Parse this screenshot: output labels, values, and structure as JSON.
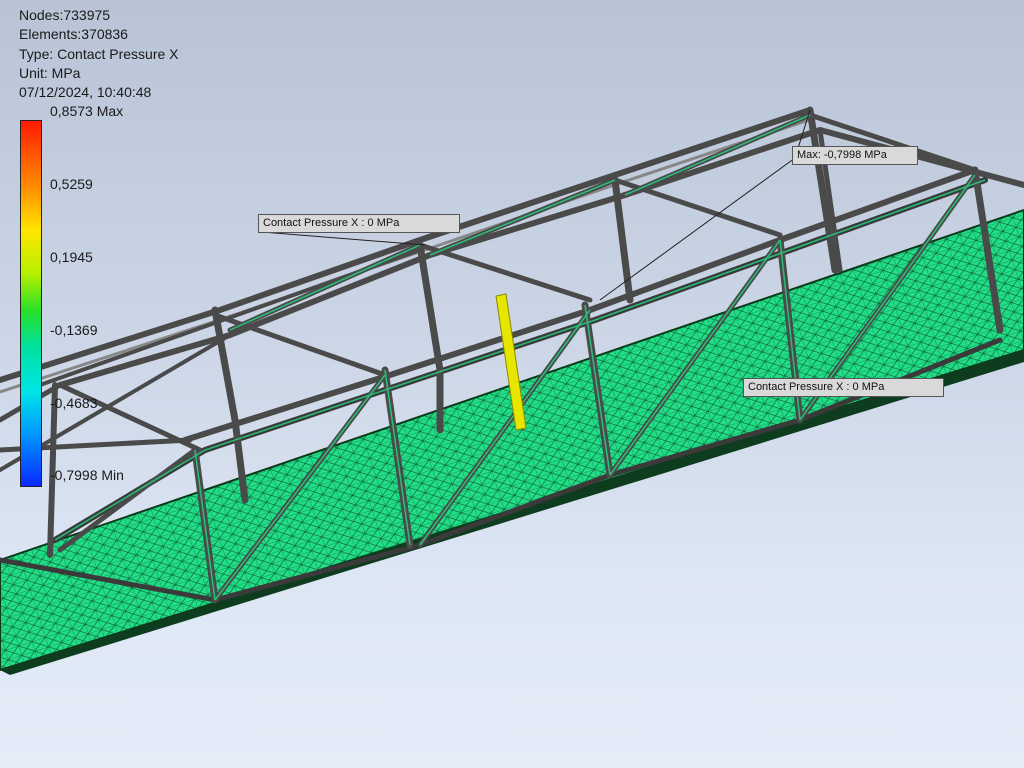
{
  "info": {
    "nodes": "Nodes:733975",
    "elements": "Elements:370836",
    "type": "Type: Contact Pressure X",
    "unit": "Unit: MPa",
    "timestamp": "07/12/2024, 10:40:48"
  },
  "legend": {
    "max": "0,8573 Max",
    "v1": "0,5259",
    "v2": "0,1945",
    "v3": "-0,1369",
    "v4": "-0,4683",
    "min": "-0,7998 Min"
  },
  "callouts": {
    "left": "Contact Pressure X : 0 MPa",
    "max": "Max: -0,7998 MPa",
    "right": "Contact Pressure X : 0 MPa"
  },
  "colors": {
    "background_top": "#b8c4d6",
    "background_bottom": "#e4ecf8",
    "deck_mesh": "#22dd88",
    "truss_members": "#555555",
    "highlight_member": "#e6e600"
  }
}
